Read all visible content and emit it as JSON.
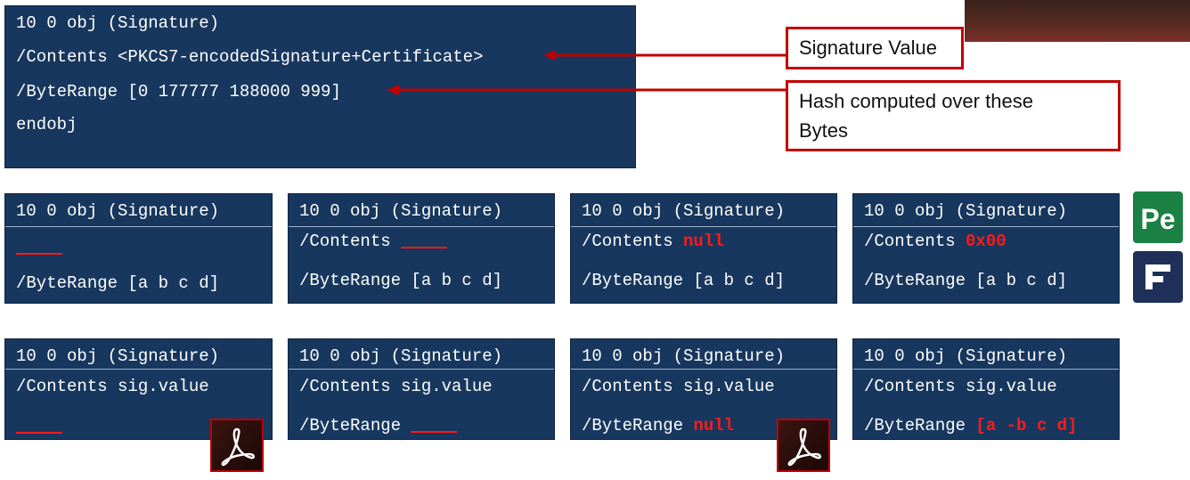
{
  "main_box": {
    "lines": [
      "10 0 obj (Signature)",
      "/Contents <PKCS7-encodedSignature+Certificate>",
      "/ByteRange [0 177777 188000 999]",
      "endobj"
    ]
  },
  "callouts": {
    "signature_value": "Signature Value",
    "hash_line1": "Hash computed over these",
    "hash_line2": "Bytes"
  },
  "row1": {
    "header": "10 0 obj (Signature)",
    "box2_contents": "/Contents ",
    "box3_contents": "/Contents ",
    "box3_value": "null",
    "box4_contents": "/Contents ",
    "box4_value": "0x00",
    "byterange": "/ByteRange [a b c d]"
  },
  "row2": {
    "header": "10 0 obj (Signature)",
    "contents": "/Contents sig.value",
    "byterange_label": "/ByteRange ",
    "box3_value": "null",
    "box4_value": "[a -b c d]"
  },
  "icons": {
    "pe": "pe-icon",
    "pdfx": "pdf-editor-icon",
    "acrobat": "acrobat-reader-icon"
  },
  "colors": {
    "box_bg": "#17375e",
    "highlight": "#ff1a1a",
    "callout_border": "#c00000"
  }
}
